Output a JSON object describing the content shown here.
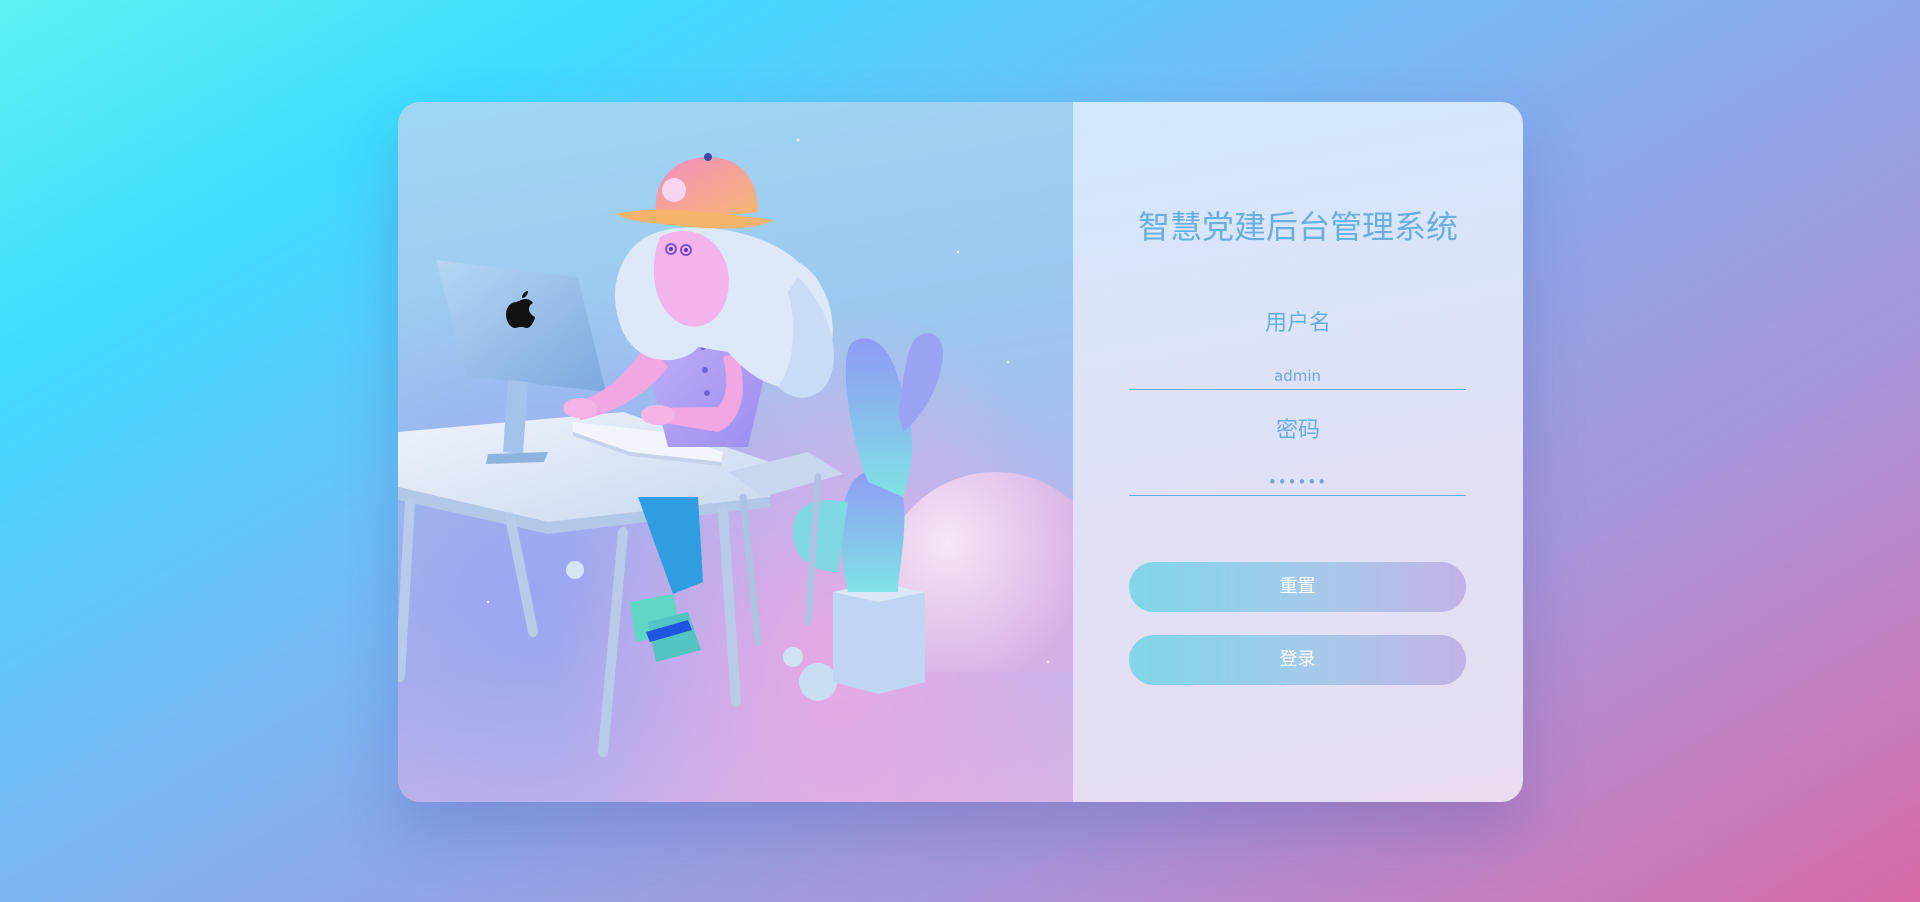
{
  "login": {
    "title": "智慧党建后台管理系统",
    "username_label": "用户名",
    "username_value": "admin",
    "password_label": "密码",
    "password_value": "••••••",
    "reset_label": "重置",
    "login_label": "登录"
  },
  "colors": {
    "accent": "#6aaee0",
    "button_gradient_start": "#80d6e8",
    "button_gradient_end": "#c3b2e5",
    "background_start": "#5ef2f2",
    "background_end": "#d86aa6"
  },
  "illustration": {
    "subject": "3d-person-at-computer-desk",
    "icon": "apple-logo-icon"
  }
}
